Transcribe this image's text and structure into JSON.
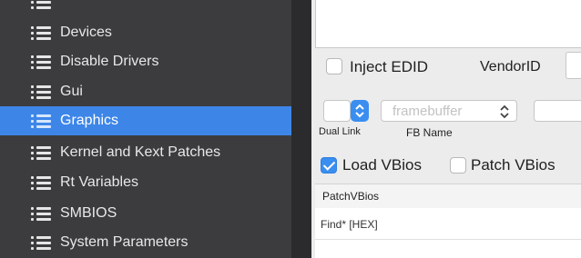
{
  "sidebar": {
    "items": [
      {
        "label": "Devices",
        "selected": false
      },
      {
        "label": "Disable Drivers",
        "selected": false
      },
      {
        "label": "Gui",
        "selected": false
      },
      {
        "label": "Graphics",
        "selected": true
      },
      {
        "label": "Kernel and Kext Patches",
        "selected": false
      },
      {
        "label": "Rt Variables",
        "selected": false
      },
      {
        "label": "SMBIOS",
        "selected": false
      },
      {
        "label": "System Parameters",
        "selected": false
      }
    ]
  },
  "graphics": {
    "inject_edid": {
      "label": "Inject EDID",
      "checked": false
    },
    "vendor_id": {
      "label": "VendorID",
      "value": ""
    },
    "dual_link": {
      "label": "Dual Link",
      "value": ""
    },
    "fb_name": {
      "label": "FB Name",
      "placeholder": "framebuffer"
    },
    "load_vbios": {
      "label": "Load VBios",
      "checked": true
    },
    "patch_vbios": {
      "label": "Patch VBios",
      "checked": false
    },
    "patch_vbios_section": {
      "title": "PatchVBios",
      "columns": [
        "Find* [HEX]"
      ]
    }
  },
  "colors": {
    "sidebar_bg": "#3c3c3e",
    "selection": "#3d86e8",
    "accent": "#3a8ef0"
  }
}
